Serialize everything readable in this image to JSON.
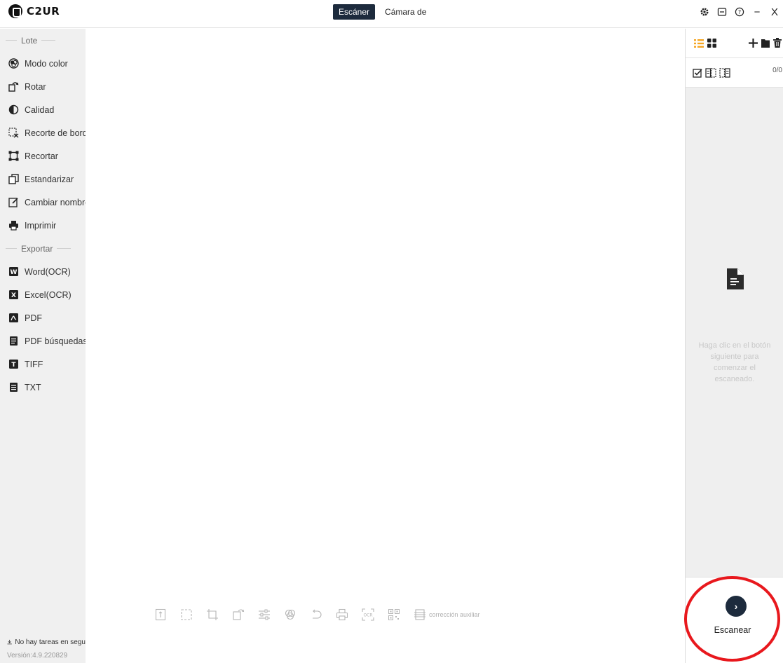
{
  "app": {
    "brand": "C2UR"
  },
  "mode_tabs": [
    {
      "label": "Escáner",
      "active": true
    },
    {
      "label": "Cámara de",
      "active": false
    }
  ],
  "window_controls": [
    {
      "icon": "gear-icon"
    },
    {
      "icon": "feedback-icon"
    },
    {
      "icon": "help-icon"
    },
    {
      "icon": "minimize-icon",
      "glyph": "−"
    },
    {
      "icon": "close-icon",
      "glyph": "X"
    }
  ],
  "sidebar": {
    "batch_header": "Lote",
    "batch_items": [
      {
        "label": "Modo color",
        "icon": "color-mode-icon"
      },
      {
        "label": "Rotar",
        "icon": "rotate-icon"
      },
      {
        "label": "Calidad",
        "icon": "quality-icon"
      },
      {
        "label": "Recorte de borde s",
        "icon": "edge-crop-icon"
      },
      {
        "label": "Recortar",
        "icon": "crop-icon"
      },
      {
        "label": "Estandarizar",
        "icon": "standardize-icon"
      },
      {
        "label": "Cambiar nombre",
        "icon": "rename-icon"
      },
      {
        "label": "Imprimir",
        "icon": "print-icon"
      }
    ],
    "export_header": "Exportar",
    "export_items": [
      {
        "label": "Word(OCR)",
        "icon": "word-icon",
        "badge": "W"
      },
      {
        "label": "Excel(OCR)",
        "icon": "excel-icon",
        "badge": "X"
      },
      {
        "label": "PDF",
        "icon": "pdf-icon"
      },
      {
        "label": "PDF búsquedas",
        "icon": "searchable-pdf-icon"
      },
      {
        "label": "TIFF",
        "icon": "tiff-icon",
        "badge": "T"
      },
      {
        "label": "TXT",
        "icon": "txt-icon"
      }
    ],
    "task_status": "No hay tareas en segu",
    "version": "Versión:4.9.220829"
  },
  "toolbar": {
    "tools": [
      "split-icon",
      "select-area-icon",
      "crop-tool-icon",
      "rotate-tool-icon",
      "adjust-icon",
      "color-icon",
      "undo-icon",
      "print-tool-icon",
      "ocr-icon",
      "qr-icon"
    ],
    "ocr_text": "OCR",
    "aux_label": "corrección auxiliar"
  },
  "right_panel": {
    "counter": "0/0",
    "empty_message": "Haga clic en el botón siguiente para comenzar el escaneado.",
    "scan_label": "Escanear",
    "scan_glyph": "›"
  },
  "colors": {
    "accent_dark": "#1d2b3d",
    "list_view_orange": "#f5a623",
    "highlight_red": "#e8181d"
  }
}
